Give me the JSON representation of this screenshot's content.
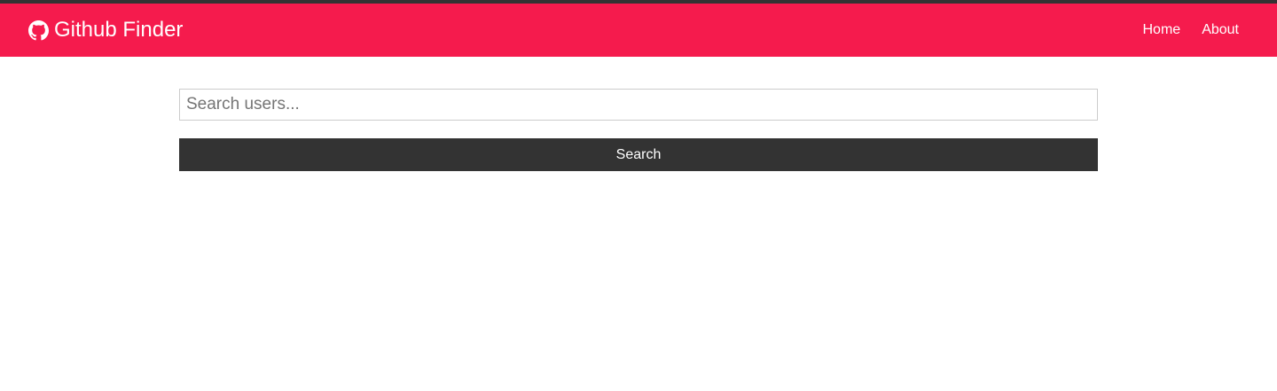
{
  "colors": {
    "top_strip": "#333333",
    "navbar": "#f51b4d",
    "navbar_text": "#ffffff",
    "button": "#333333",
    "input_border": "#cccccc"
  },
  "navbar": {
    "brand": {
      "icon": "github-icon",
      "title": "Github Finder"
    },
    "links": [
      {
        "label": "Home"
      },
      {
        "label": "About"
      }
    ]
  },
  "search": {
    "value": "",
    "placeholder": "Search users...",
    "button_label": "Search"
  }
}
